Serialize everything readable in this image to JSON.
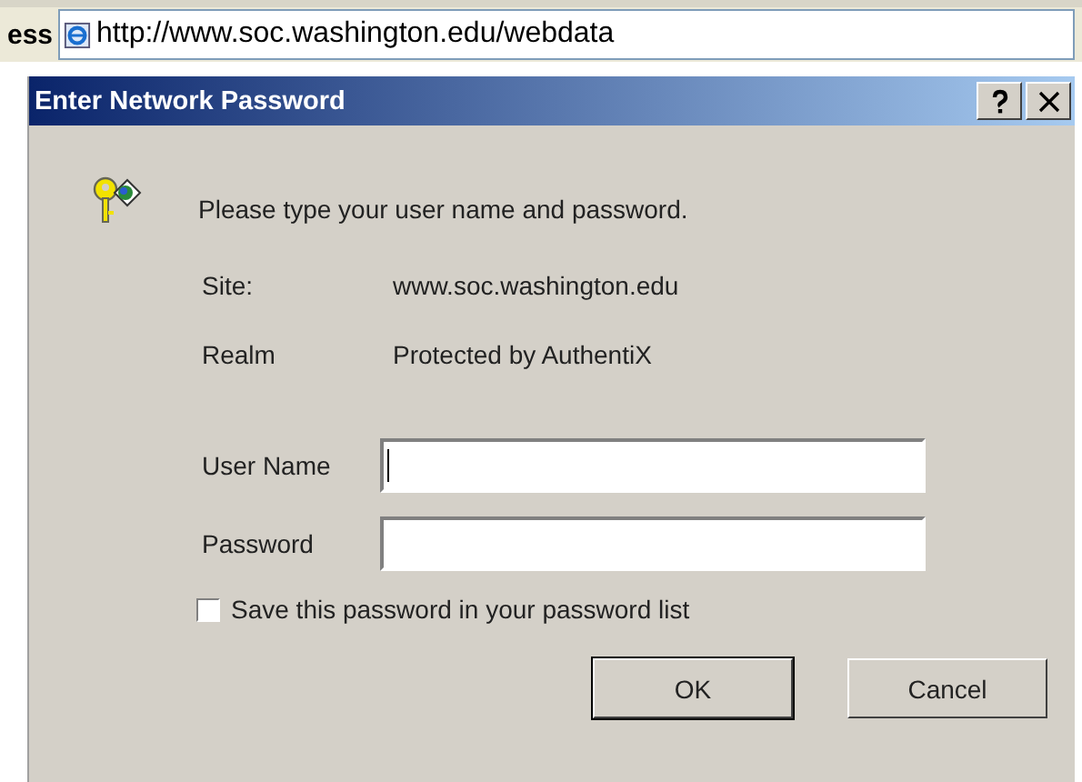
{
  "address_bar": {
    "label": "ess",
    "url": "http://www.soc.washington.edu/webdata"
  },
  "dialog": {
    "title": "Enter Network Password",
    "prompt": "Please type your user name and password.",
    "info": [
      {
        "label": "Site:",
        "value": "www.soc.washington.edu"
      },
      {
        "label": "Realm",
        "value": "Protected by AuthentiX"
      }
    ],
    "fields": [
      {
        "label": "User Name",
        "focused": true
      },
      {
        "label": "Password",
        "focused": false
      }
    ],
    "save_password": {
      "label": "Save this password in your password list",
      "checked": false
    },
    "buttons": [
      {
        "label": "OK",
        "default": true
      },
      {
        "label": "Cancel",
        "default": false
      }
    ]
  }
}
